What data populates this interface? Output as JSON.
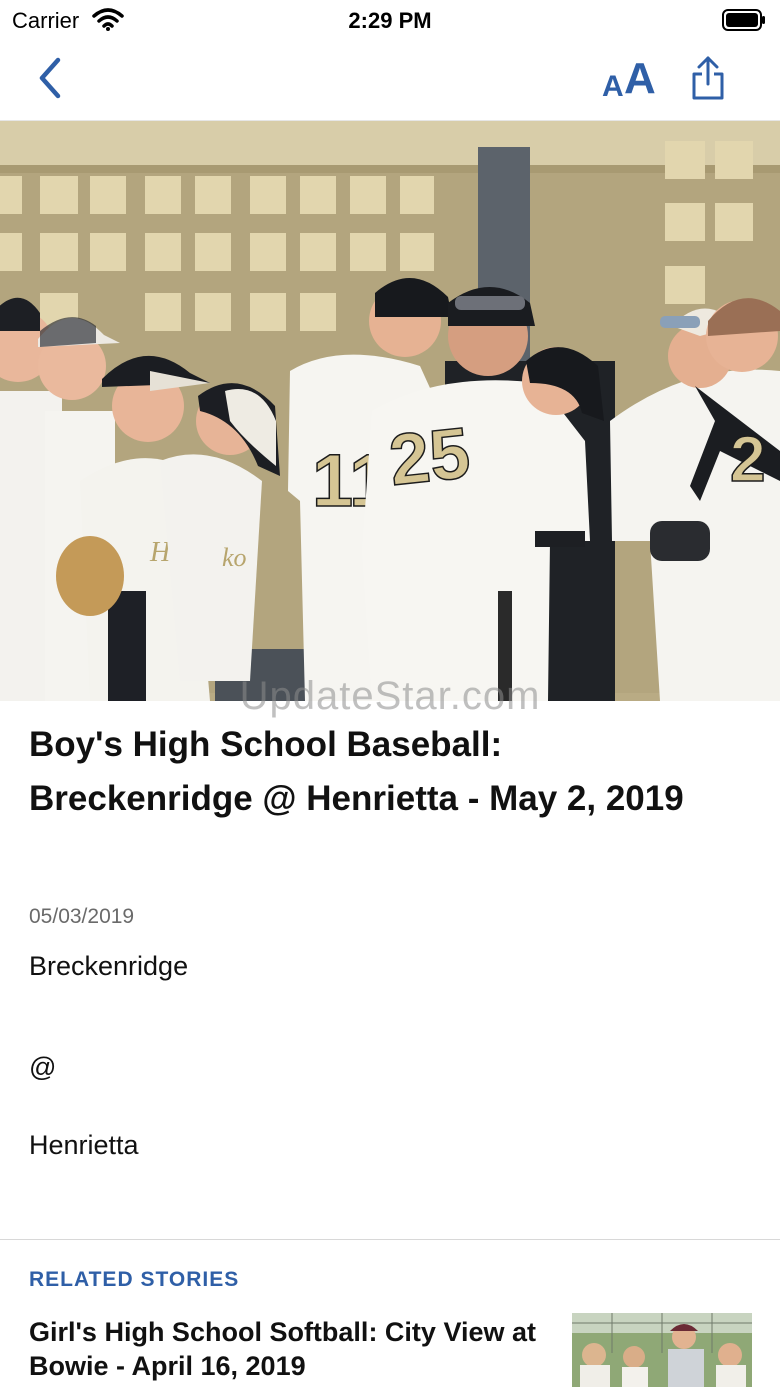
{
  "status_bar": {
    "carrier": "Carrier",
    "time": "2:29 PM"
  },
  "nav": {
    "back_icon": "chevron-left-icon",
    "text_size_small": "A",
    "text_size_large": "A",
    "share_icon": "share-icon",
    "accent_color": "#2f5fa7"
  },
  "hero": {
    "description_icon": "photo",
    "watermark": "UpdateStar.com",
    "jersey_numbers": [
      "11",
      "25"
    ]
  },
  "article": {
    "title": "Boy's High School Baseball: Breckenridge @ Henrietta - May 2, 2019",
    "date": "05/03/2019",
    "body": [
      "Breckenridge",
      "@",
      "Henrietta"
    ]
  },
  "related": {
    "heading": "RELATED STORIES",
    "items": [
      {
        "title": "Girl's High School Softball: City View at Bowie - April 16, 2019"
      }
    ]
  }
}
